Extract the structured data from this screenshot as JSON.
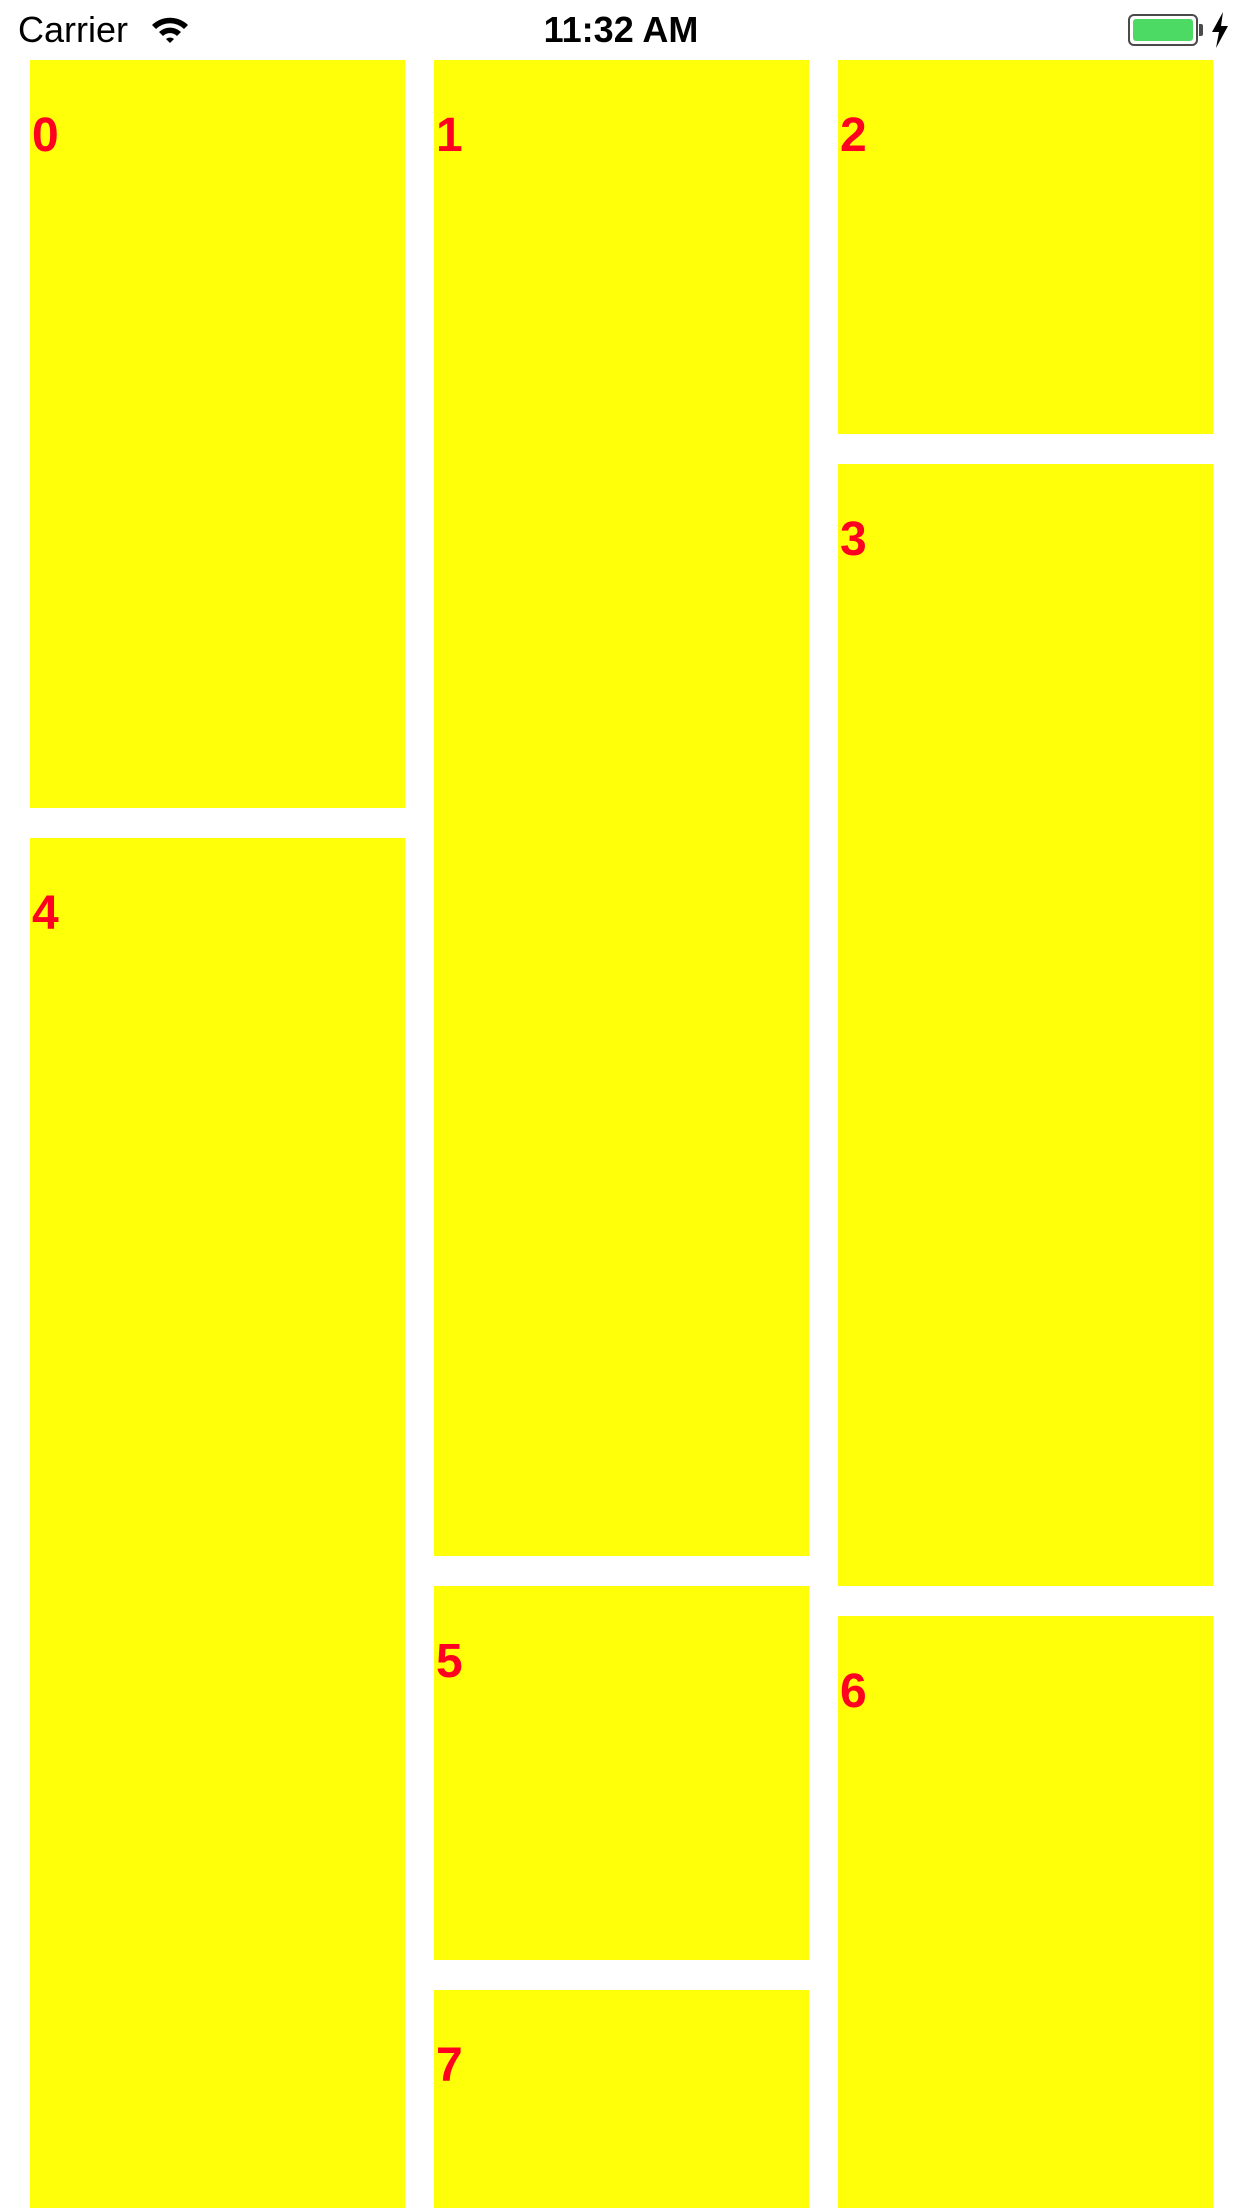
{
  "status_bar": {
    "carrier": "Carrier",
    "time": "11:32 AM",
    "wifi_icon": "wifi-icon",
    "battery_icon": "battery-icon",
    "charging_icon": "lightning-bolt-icon",
    "battery_level": 1.0,
    "battery_color": "#4cd964"
  },
  "colors": {
    "cell_background": "#ffff09",
    "cell_label": "#ff0021"
  },
  "cells": [
    {
      "label": "0"
    },
    {
      "label": "1"
    },
    {
      "label": "2"
    },
    {
      "label": "3"
    },
    {
      "label": "4"
    },
    {
      "label": "5"
    },
    {
      "label": "6"
    },
    {
      "label": "7"
    }
  ]
}
